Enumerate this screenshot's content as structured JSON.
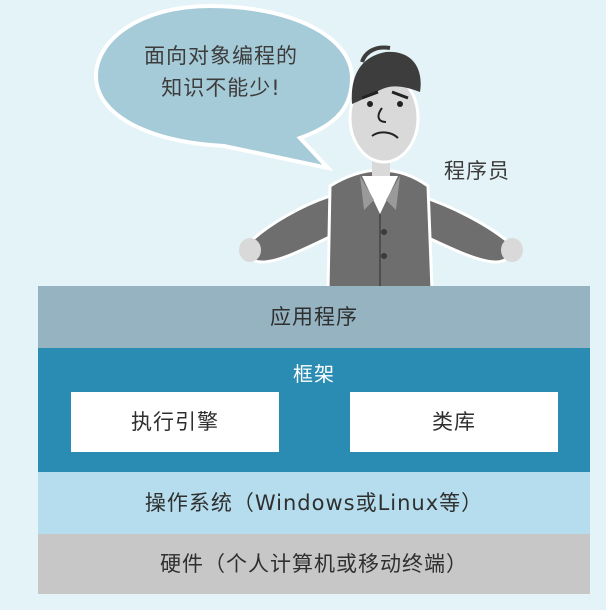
{
  "bubble": {
    "line1": "面向对象编程的",
    "line2": "知识不能少!"
  },
  "role": "程序员",
  "layers": {
    "application": "应用程序",
    "framework": {
      "title": "框架",
      "engine": "执行引擎",
      "library": "类库"
    },
    "os": "操作系统（Windows或Linux等）",
    "hardware": "硬件（个人计算机或移动终端）"
  },
  "colors": {
    "background": "#e4f3f7",
    "bubble": "#a6cbd8",
    "application": "#96b3c2",
    "framework": "#2a8cb3",
    "os": "#b5dded",
    "hardware": "#c7c7c7",
    "person_suit": "#6e6e6e",
    "person_skin": "#d9d9d9"
  },
  "icons": [
    "speech-bubble",
    "programmer-figure"
  ]
}
